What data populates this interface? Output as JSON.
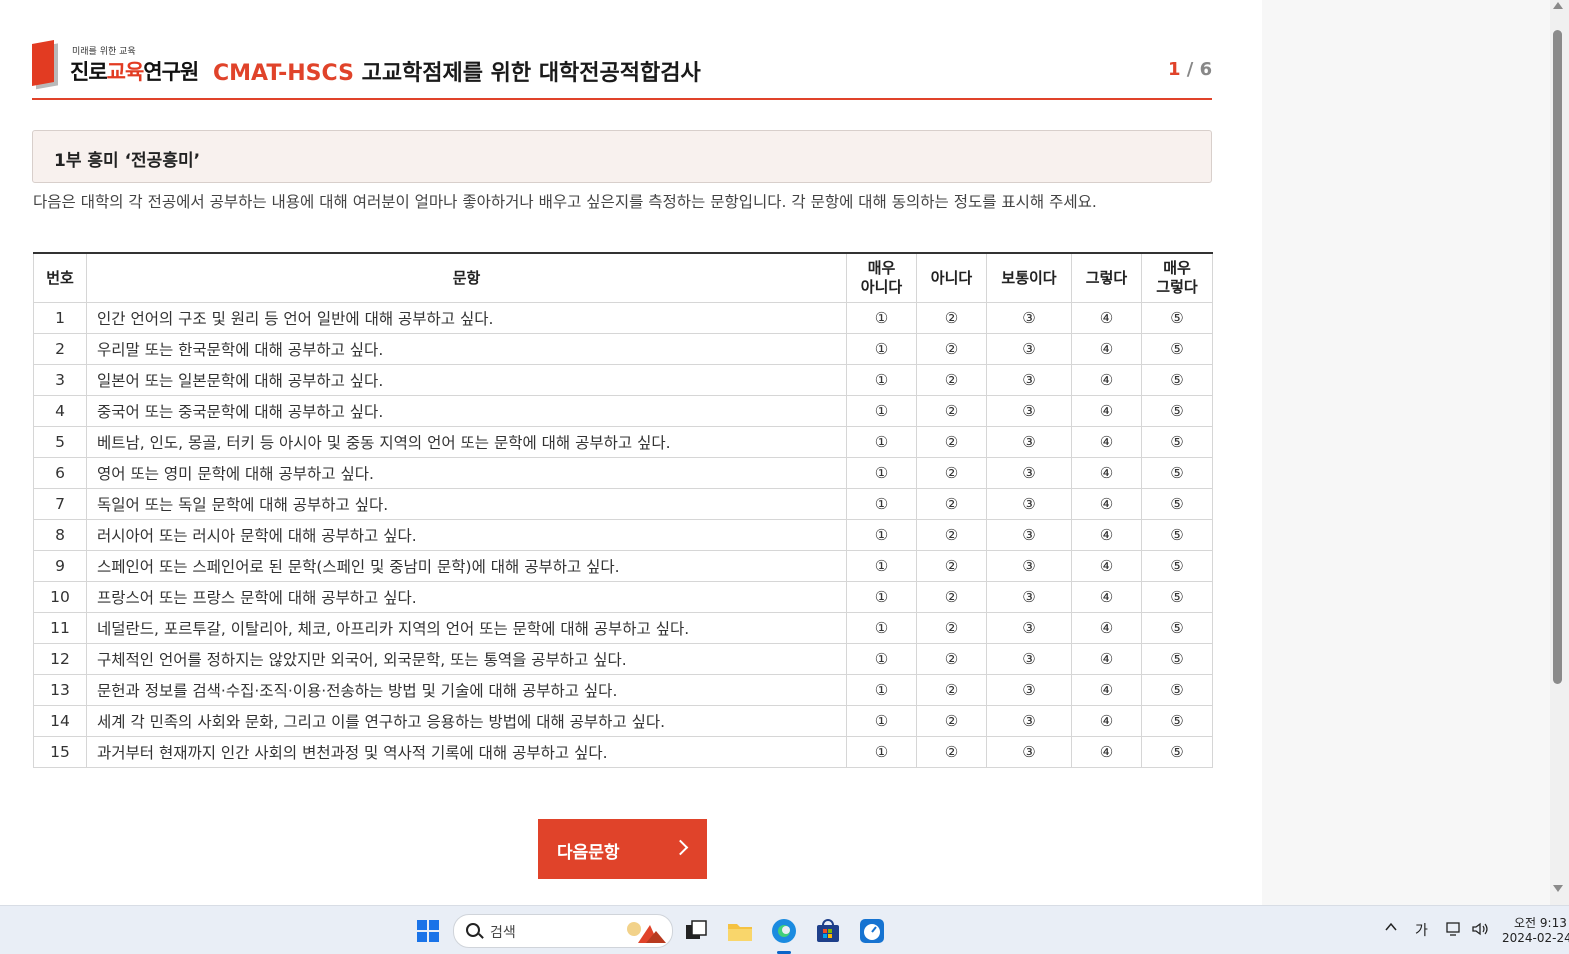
{
  "header": {
    "logo_tagline": "미래를 위한 교육",
    "logo_main_a": "진로",
    "logo_main_b": "교육",
    "logo_main_c": "연구원",
    "title_code": "CMAT-HSCS",
    "title_rest": " 고교학점제를 위한 대학전공적합검사",
    "page_current": "1",
    "page_total": " / 6"
  },
  "section": {
    "title": "1부 흥미 ‘전공흥미’",
    "instruction": "다음은 대학의 각 전공에서 공부하는 내용에 대해 여러분이 얼마나 좋아하거나 배우고 싶은지를 측정하는 문항입니다. 각 문항에 대해 동의하는 정도를 표시해 주세요."
  },
  "table": {
    "headers": [
      "번호",
      "문항",
      "매우\n아니다",
      "아니다",
      "보통이다",
      "그렇다",
      "매우\n그렇다"
    ],
    "options": [
      "①",
      "②",
      "③",
      "④",
      "⑤"
    ],
    "rows": [
      {
        "num": "1",
        "text": "인간 언어의 구조 및 원리 등 언어 일반에 대해 공부하고 싶다."
      },
      {
        "num": "2",
        "text": "우리말 또는 한국문학에 대해 공부하고 싶다."
      },
      {
        "num": "3",
        "text": "일본어 또는 일본문학에 대해 공부하고 싶다."
      },
      {
        "num": "4",
        "text": "중국어 또는 중국문학에 대해 공부하고 싶다."
      },
      {
        "num": "5",
        "text": "베트남, 인도, 몽골, 터키 등 아시아 및 중동 지역의 언어 또는 문학에 대해 공부하고 싶다."
      },
      {
        "num": "6",
        "text": "영어 또는 영미 문학에 대해 공부하고 싶다."
      },
      {
        "num": "7",
        "text": "독일어 또는 독일 문학에 대해 공부하고 싶다."
      },
      {
        "num": "8",
        "text": "러시아어 또는 러시아 문학에 대해 공부하고 싶다."
      },
      {
        "num": "9",
        "text": "스페인어 또는 스페인어로 된 문학(스페인 및 중남미 문학)에 대해 공부하고 싶다."
      },
      {
        "num": "10",
        "text": "프랑스어 또는 프랑스 문학에 대해 공부하고 싶다."
      },
      {
        "num": "11",
        "text": "네덜란드, 포르투갈, 이탈리아, 체코, 아프리카 지역의 언어 또는 문학에 대해 공부하고 싶다."
      },
      {
        "num": "12",
        "text": "구체적인 언어를 정하지는 않았지만 외국어, 외국문학, 또는 통역을 공부하고 싶다."
      },
      {
        "num": "13",
        "text": "문헌과 정보를 검색·수집·조직·이용·전송하는 방법 및 기술에 대해 공부하고 싶다."
      },
      {
        "num": "14",
        "text": "세계 각 민족의 사회와 문화, 그리고 이를 연구하고 응용하는 방법에 대해 공부하고 싶다."
      },
      {
        "num": "15",
        "text": "과거부터 현재까지 인간 사회의 변천과정 및 역사적 기록에 대해 공부하고 싶다."
      }
    ]
  },
  "next_button": {
    "label": "다음문항"
  },
  "taskbar": {
    "search_placeholder": "검색",
    "ime_indicator": "가",
    "clock_time": "오전 9:13",
    "clock_date": "2024-02-24"
  },
  "colors": {
    "accent": "#e0432a",
    "section_bg": "#f8f1ee",
    "taskbar_bg": "#e9eef6"
  }
}
